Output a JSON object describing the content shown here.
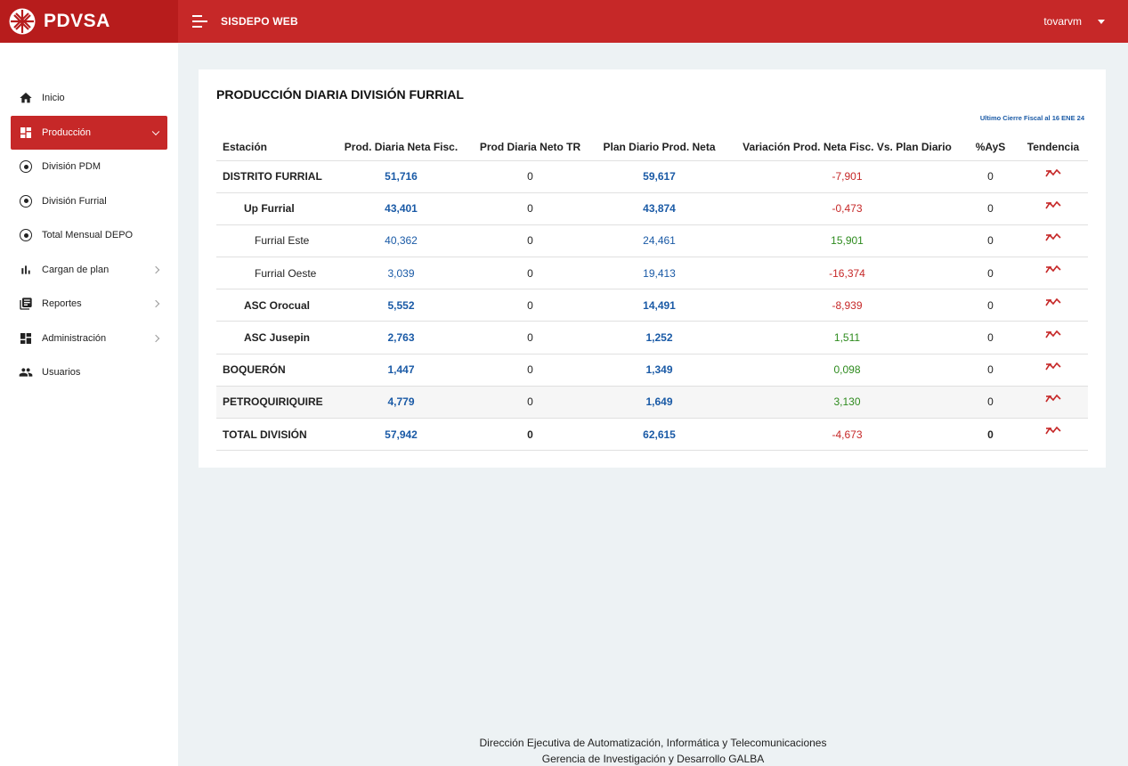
{
  "header": {
    "brand": "PDVSA",
    "app_title": "SISDEPO WEB",
    "user": "tovarvm"
  },
  "sidebar": {
    "items": [
      {
        "label": "Inicio",
        "icon": "home-icon"
      },
      {
        "label": "Producción",
        "icon": "dashboard-icon",
        "active": true,
        "expanded": true
      },
      {
        "label": "División PDM",
        "icon": "radio-icon"
      },
      {
        "label": "División Furrial",
        "icon": "radio-icon"
      },
      {
        "label": "Total Mensual DEPO",
        "icon": "radio-icon"
      },
      {
        "label": "Cargan de plan",
        "icon": "bar-chart-icon"
      },
      {
        "label": "Reportes",
        "icon": "library-books-icon"
      },
      {
        "label": "Administración",
        "icon": "dashboard-icon"
      },
      {
        "label": "Usuarios",
        "icon": "people-icon"
      }
    ]
  },
  "main": {
    "title": "PRODUCCIÓN DIARIA DIVISIÓN FURRIAL",
    "note": "Ultimo Cierre Fiscal al 16 ENE 24",
    "columns": [
      "Estación",
      "Prod. Diaria Neta Fisc.",
      "Prod Diaria Neto TR",
      "Plan Diario Prod. Neta",
      "Variación Prod. Neta Fisc. Vs. Plan Diario",
      "%AyS",
      "Tendencia"
    ],
    "rows": [
      {
        "station": "DISTRITO FURRIAL",
        "fisc": "51,716",
        "tr": "0",
        "plan": "59,617",
        "var": "-7,901",
        "ays": "0"
      },
      {
        "station": "Up Furrial",
        "fisc": "43,401",
        "tr": "0",
        "plan": "43,874",
        "var": "-0,473",
        "ays": "0"
      },
      {
        "station": "Furrial Este",
        "fisc": "40,362",
        "tr": "0",
        "plan": "24,461",
        "var": "15,901",
        "ays": "0"
      },
      {
        "station": "Furrial Oeste",
        "fisc": "3,039",
        "tr": "0",
        "plan": "19,413",
        "var": "-16,374",
        "ays": "0"
      },
      {
        "station": "ASC Orocual",
        "fisc": "5,552",
        "tr": "0",
        "plan": "14,491",
        "var": "-8,939",
        "ays": "0"
      },
      {
        "station": "ASC Jusepin",
        "fisc": "2,763",
        "tr": "0",
        "plan": "1,252",
        "var": "1,511",
        "ays": "0"
      },
      {
        "station": "BOQUERÓN",
        "fisc": "1,447",
        "tr": "0",
        "plan": "1,349",
        "var": "0,098",
        "ays": "0"
      },
      {
        "station": "PETROQUIRIQUIRE",
        "fisc": "4,779",
        "tr": "0",
        "plan": "1,649",
        "var": "3,130",
        "ays": "0"
      },
      {
        "station": "TOTAL DIVISIÓN",
        "fisc": "57,942",
        "tr": "0",
        "plan": "62,615",
        "var": "-4,673",
        "ays": "0"
      }
    ],
    "trend_icon": "trending-down-icon"
  },
  "footer": {
    "line1": "Dirección Ejecutiva de Automatización, Informática y Telecomunicaciones",
    "line2": "Gerencia de Investigación y Desarrollo GALBA"
  },
  "colors": {
    "brand_red": "#c62828",
    "brand_red_dark": "#b71c1c",
    "value_blue": "#1a5aa6",
    "negative_red": "#c62828",
    "positive_green": "#2e8b1e",
    "page_bg": "#edf2f4"
  }
}
